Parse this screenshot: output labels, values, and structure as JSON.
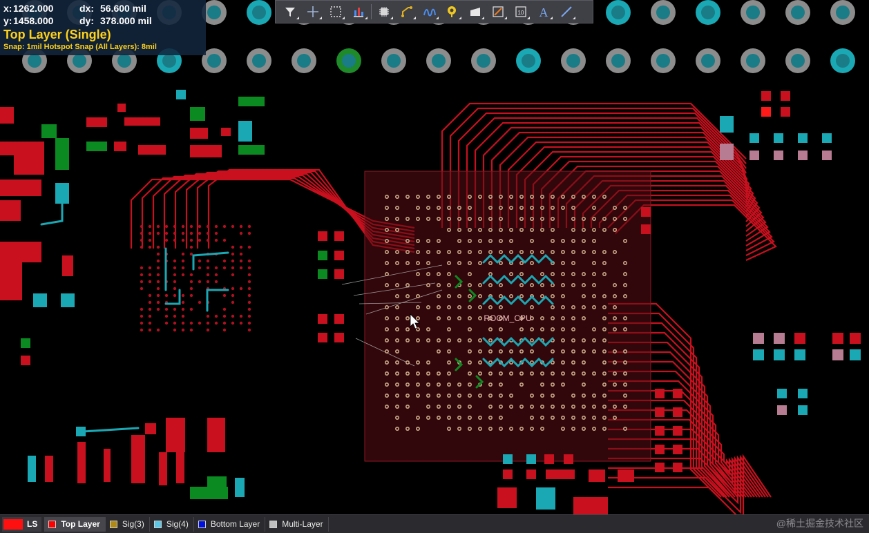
{
  "hud": {
    "x_label": "x:",
    "x_value": "1262.000",
    "dx_label": "dx:",
    "dx_value": "56.600 mil",
    "y_label": "y:",
    "y_value": "1458.000",
    "dy_label": "dy:",
    "dy_value": "378.000 mil",
    "layer": "Top Layer (Single)",
    "snap": "Snap: 1mil Hotspot Snap (All Layers): 8mil"
  },
  "toolbar": {
    "tools": [
      {
        "name": "filter-icon"
      },
      {
        "name": "cross-probe-icon"
      },
      {
        "name": "select-rectangle-icon"
      },
      {
        "name": "align-icon"
      },
      {
        "name": "component-icon"
      },
      {
        "name": "interactive-route-icon"
      },
      {
        "name": "diff-pair-icon"
      },
      {
        "name": "via-icon"
      },
      {
        "name": "polygon-pour-icon"
      },
      {
        "name": "keepout-icon"
      },
      {
        "name": "dimension-icon"
      },
      {
        "name": "string-text-icon"
      },
      {
        "name": "line-icon"
      }
    ]
  },
  "board": {
    "room_label": "ROOM_CPU",
    "colors": {
      "top": "#c8101e",
      "bottom": "#1aa8b4",
      "sig3": "#0c8a22",
      "multi": "#8c8c8c",
      "room": "#5a0c14"
    }
  },
  "layers": {
    "ls_label": "LS",
    "tabs": [
      {
        "label": "Top Layer",
        "color": "#ff0000",
        "active": true
      },
      {
        "label": "Sig(3)",
        "color": "#b08a14",
        "active": false
      },
      {
        "label": "Sig(4)",
        "color": "#5ac8e6",
        "active": false
      },
      {
        "label": "Bottom Layer",
        "color": "#0010e0",
        "active": false
      },
      {
        "label": "Multi-Layer",
        "color": "#c0c0c0",
        "active": false
      }
    ]
  },
  "watermark": "@稀土掘金技术社区"
}
